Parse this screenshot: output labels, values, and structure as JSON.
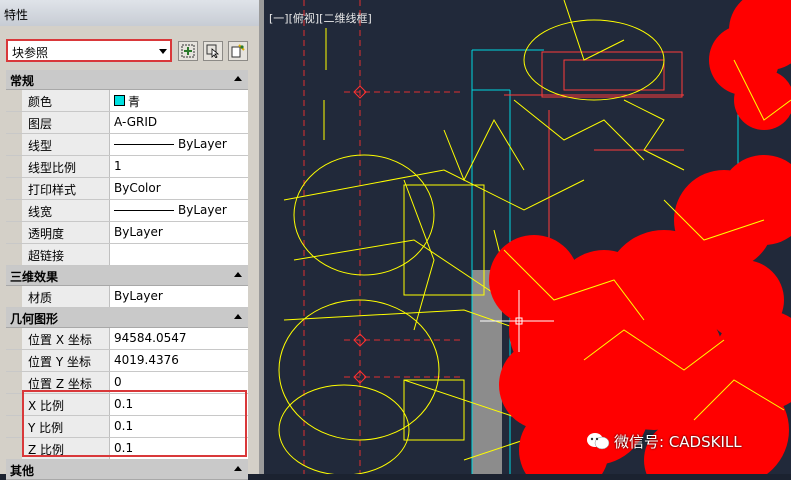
{
  "panel": {
    "title": "特性",
    "selector": "块参照",
    "toolbar_icons": [
      "quick-select-icon",
      "select-objects-icon",
      "toggle-pickadd-icon"
    ]
  },
  "sections": {
    "general": {
      "title": "常规",
      "color_label": "颜色",
      "color_value": "青",
      "layer_label": "图层",
      "layer_value": "A-GRID",
      "linetype_label": "线型",
      "linetype_value": "ByLayer",
      "ltscale_label": "线型比例",
      "ltscale_value": "1",
      "plotstyle_label": "打印样式",
      "plotstyle_value": "ByColor",
      "lineweight_label": "线宽",
      "lineweight_value": "ByLayer",
      "transparency_label": "透明度",
      "transparency_value": "ByLayer",
      "hyperlink_label": "超链接",
      "hyperlink_value": ""
    },
    "three_d": {
      "title": "三维效果",
      "material_label": "材质",
      "material_value": "ByLayer"
    },
    "geometry": {
      "title": "几何图形",
      "pos_x_label": "位置 X 坐标",
      "pos_x_value": "94584.0547",
      "pos_y_label": "位置 Y 坐标",
      "pos_y_value": "4019.4376",
      "pos_z_label": "位置 Z 坐标",
      "pos_z_value": "0",
      "scale_x_label": "X 比例",
      "scale_x_value": "0.1",
      "scale_y_label": "Y 比例",
      "scale_y_value": "0.1",
      "scale_z_label": "Z 比例",
      "scale_z_value": "0.1"
    },
    "misc": {
      "title": "其他"
    }
  },
  "canvas": {
    "viewport_label": "[一][俯视][二维线框]",
    "watermark": "微信号: CADSKILL"
  },
  "colors": {
    "highlight": "#d9383a",
    "cyan_swatch": "#00e0e0",
    "canvas_bg": "#21293a",
    "red_fill": "#ff0000",
    "yellow_lines": "#ffff00"
  }
}
